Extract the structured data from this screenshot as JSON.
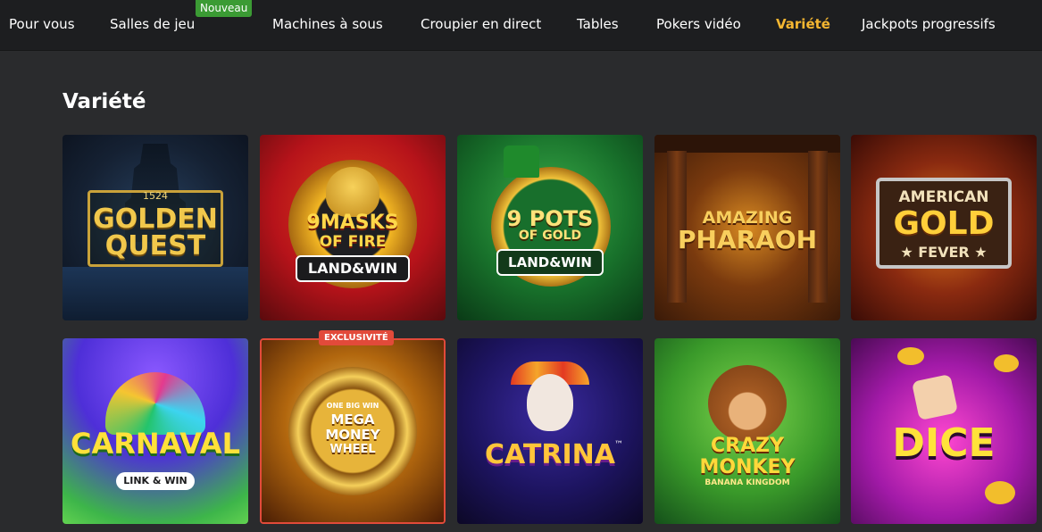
{
  "nav": {
    "items": [
      {
        "label": "Pour vous"
      },
      {
        "label": "Salles de jeu"
      },
      {
        "label": "Machines à sous"
      },
      {
        "label": "Croupier en direct"
      },
      {
        "label": "Tables"
      },
      {
        "label": "Pokers vidéo"
      },
      {
        "label": "Variété"
      },
      {
        "label": "Jackpots progressifs"
      }
    ],
    "active": "Variété",
    "new_badge": "Nouveau"
  },
  "section": {
    "title": "Variété"
  },
  "games": [
    {
      "name": "Golden Quest",
      "logo": {
        "year": "1524",
        "line1": "GOLDEN",
        "line2": "QUEST"
      }
    },
    {
      "name": "9 Masks of Fire Land & Win",
      "logo": {
        "line1": "9MASKS",
        "line2": "OF FIRE",
        "badge": "LAND&WIN"
      }
    },
    {
      "name": "9 Pots of Gold Land & Win",
      "logo": {
        "line1": "9 POTS",
        "line2": "OF GOLD",
        "badge": "LAND&WIN"
      }
    },
    {
      "name": "Amazing Pharaoh",
      "logo": {
        "line1": "AMAZING",
        "line2": "PHARAOH"
      }
    },
    {
      "name": "American Gold Fever",
      "logo": {
        "line1": "AMERICAN",
        "line2": "GOLD",
        "line3": "★ FEVER ★"
      }
    },
    {
      "name": "Carnaval Link & Win",
      "logo": {
        "line1": "CARNAVAL",
        "badge": "LINK & WIN"
      }
    },
    {
      "name": "Mega Money Wheel",
      "logo": {
        "line0": "ONE BIG WIN",
        "line1": "MEGA",
        "line2": "MONEY",
        "line3": "WHEEL"
      },
      "badge": "EXCLUSIVITÉ"
    },
    {
      "name": "Catrina",
      "logo": {
        "line1": "CATRINA",
        "tm": "™"
      }
    },
    {
      "name": "Crazy Monkey Banana Kingdom",
      "logo": {
        "line1": "CRAZY",
        "line2": "MONKEY",
        "line3": "BANANA KINGDOM"
      }
    },
    {
      "name": "Dice",
      "logo": {
        "line1": "DICE"
      }
    }
  ],
  "colors": {
    "page_bg": "#2a2b2d",
    "nav_bg": "#1d1e20",
    "active": "#f5b731",
    "new_badge": "#3b9b34",
    "exclusive_badge": "#e24a3a"
  }
}
